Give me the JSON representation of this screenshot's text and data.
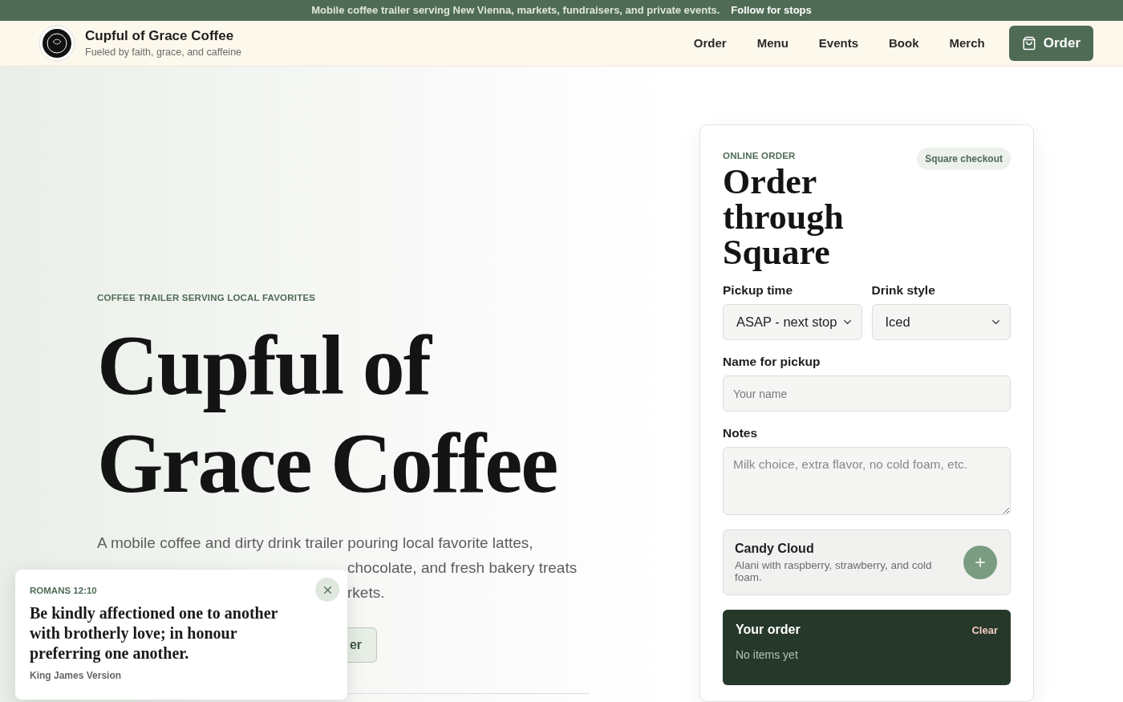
{
  "announcement": {
    "text": "Mobile coffee trailer serving New Vienna, markets, fundraisers, and private events.",
    "link": "Follow for stops"
  },
  "header": {
    "brand": {
      "name": "Cupful of Grace Coffee",
      "tagline": "Fueled by faith, grace, and caffeine"
    },
    "nav": [
      {
        "label": "Order"
      },
      {
        "label": "Menu"
      },
      {
        "label": "Events"
      },
      {
        "label": "Book"
      },
      {
        "label": "Merch"
      }
    ],
    "order_button": "Order"
  },
  "hero": {
    "eyebrow": "COFFEE TRAILER SERVING LOCAL FAVORITES",
    "title_lines": [
      "Cupful of",
      "Grace Coffee"
    ],
    "description_lines": [
      "A mobile coffee and dirty drink trailer pouring local favorite lattes,",
      "chocolate, and fresh bakery treats",
      "rkets."
    ],
    "buttons": [
      {
        "label": "er",
        "kind": "outline"
      }
    ]
  },
  "order_card": {
    "eyebrow": "ONLINE ORDER",
    "badge": "Square checkout",
    "title": "Order through Square",
    "fields": [
      {
        "label": "Pickup time",
        "kind": "select",
        "value": "ASAP - next stop"
      },
      {
        "label": "Drink style",
        "kind": "select",
        "value": "Iced"
      },
      {
        "label": "Name for pickup",
        "kind": "input",
        "placeholder": "Your name"
      },
      {
        "label": "Notes",
        "kind": "textarea",
        "placeholder": "Milk choice, extra flavor, no cold foam, etc."
      }
    ],
    "menu_items": [
      {
        "name": "Candy Cloud",
        "description": "Alani with raspberry, strawberry, and cold foam."
      }
    ],
    "summary": {
      "title": "Your order",
      "clear": "Clear",
      "empty": "No items yet"
    }
  },
  "toast": {
    "reference": "ROMANS 12:10",
    "verse": "Be kindly affectioned one to another with brotherly love; in honour preferring one another.",
    "version": "King James Version"
  }
}
